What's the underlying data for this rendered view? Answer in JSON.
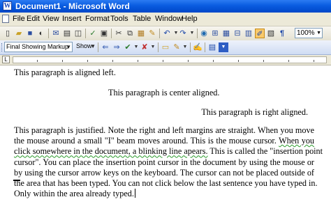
{
  "window": {
    "title": "Document1 - Microsoft Word"
  },
  "menu": [
    "File",
    "Edit",
    "View",
    "Insert",
    "Format",
    "Tools",
    "Table",
    "Window",
    "Help"
  ],
  "toolbar": {
    "zoom": "100%"
  },
  "reviewing": {
    "display_mode": "Final Showing Markup",
    "show_label": "Show"
  },
  "document": {
    "p_left": "This paragraph is aligned left.",
    "p_center": "This paragraph is center aligned.",
    "p_right": "This paragraph is right aligned.",
    "p_justified_lines": [
      "This paragraph is justified. Note the right and left margins are straight. When you move",
      "the mouse around a small \"I\" beam moves around. This is the mouse cursor.",
      "When you",
      "click somewhere in the document, a blinking line apears.",
      "This is called the \"insertion point",
      "cursor\". You can place the insertion point cursor in the document by using the mouse or",
      "by using the cursor arrow keys on the keyboard. The cursor can not be placed outside of",
      "the area that has been typed. You can not click below the last sentence you have typed in.",
      "Only within the area already typed."
    ]
  },
  "colors": {
    "title_bar": "#0a5ce0",
    "chrome": "#ece9d8",
    "grammar_underline": "#2a9a2a"
  }
}
